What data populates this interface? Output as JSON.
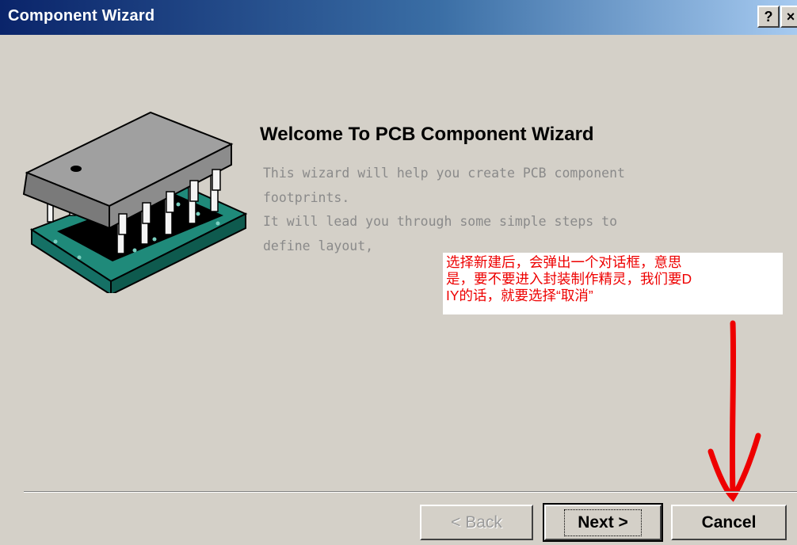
{
  "window": {
    "title": "Component Wizard"
  },
  "titlebar": {
    "help_label": "?",
    "close_label": "×"
  },
  "welcome": {
    "heading": "Welcome To PCB Component Wizard",
    "lines": [
      "This wizard will help you create PCB component",
      "footprints.",
      "It will lead you through some simple steps to",
      "define layout,"
    ]
  },
  "annotation": {
    "lines": [
      "选择新建后，会弹出一个对话框，意思",
      "是，要不要进入封装制作精灵，我们要D",
      "IY的话，就要选择“取消”"
    ]
  },
  "buttons": {
    "back_label": "< Back",
    "next_label": "Next >",
    "cancel_label": "Cancel"
  },
  "colors": {
    "annotation_text": "#ee0000",
    "arrow": "#ee0000"
  }
}
